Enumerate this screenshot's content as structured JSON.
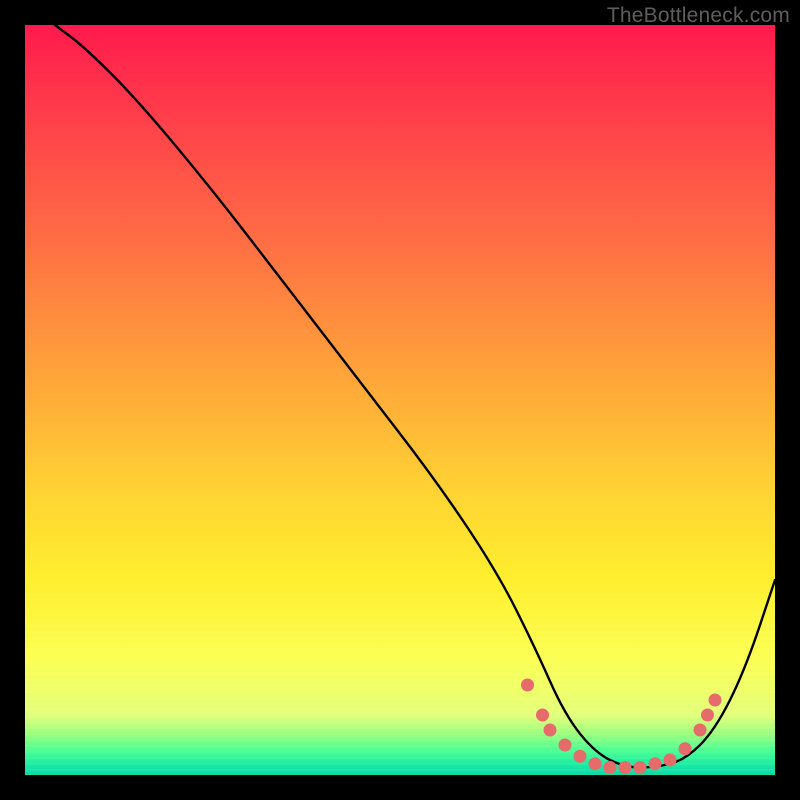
{
  "watermark": "TheBottleneck.com",
  "chart_data": {
    "type": "line",
    "title": "",
    "xlabel": "",
    "ylabel": "",
    "xlim": [
      0,
      100
    ],
    "ylim": [
      0,
      100
    ],
    "series": [
      {
        "name": "bottleneck-curve",
        "x": [
          4,
          8,
          15,
          25,
          35,
          45,
          55,
          63,
          68,
          72,
          76,
          80,
          84,
          88,
          92,
          96,
          100
        ],
        "y": [
          100,
          97,
          90,
          78,
          65,
          52,
          39,
          27,
          17,
          8,
          3,
          1,
          1,
          2,
          6,
          14,
          26
        ]
      }
    ],
    "markers": {
      "name": "highlight-dots",
      "color": "#e66b6b",
      "x": [
        67,
        69,
        70,
        72,
        74,
        76,
        78,
        80,
        82,
        84,
        86,
        88,
        90,
        91,
        92
      ],
      "y": [
        12,
        8,
        6,
        4,
        2.5,
        1.5,
        1,
        1,
        1,
        1.5,
        2,
        3.5,
        6,
        8,
        10
      ]
    },
    "gradient_stops": [
      {
        "pos": 0.0,
        "color": "#ff1a4d"
      },
      {
        "pos": 0.5,
        "color": "#ffa23a"
      },
      {
        "pos": 0.8,
        "color": "#ffee2e"
      },
      {
        "pos": 0.93,
        "color": "#9fff7e"
      },
      {
        "pos": 1.0,
        "color": "#0fd8a9"
      }
    ]
  }
}
